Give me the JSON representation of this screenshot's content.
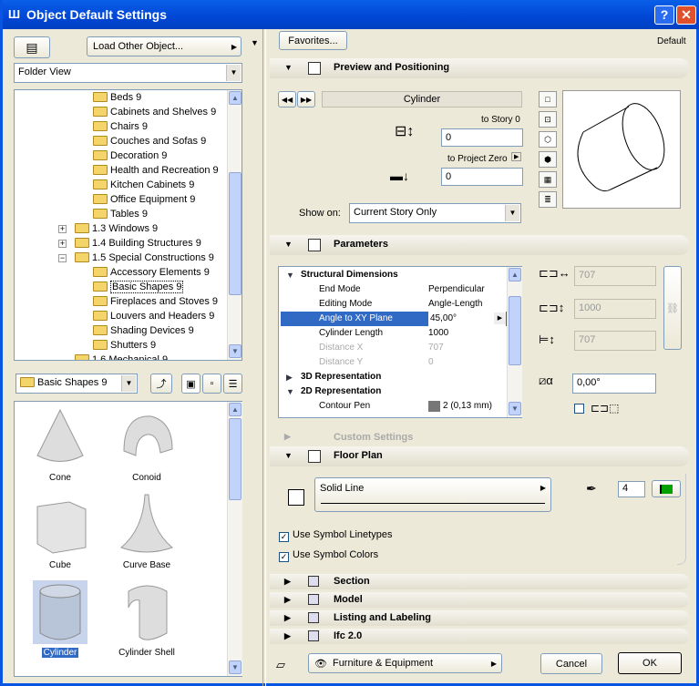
{
  "window": {
    "title": "Object Default Settings",
    "help": "?",
    "close": "✕"
  },
  "left": {
    "load_other": "Load Other Object...",
    "view_select": "Folder View",
    "tree": [
      {
        "label": "Beds 9",
        "level": 3
      },
      {
        "label": "Cabinets and Shelves 9",
        "level": 3
      },
      {
        "label": "Chairs 9",
        "level": 3
      },
      {
        "label": "Couches and Sofas 9",
        "level": 3
      },
      {
        "label": "Decoration 9",
        "level": 3
      },
      {
        "label": "Health and Recreation 9",
        "level": 3
      },
      {
        "label": "Kitchen Cabinets 9",
        "level": 3
      },
      {
        "label": "Office Equipment 9",
        "level": 3
      },
      {
        "label": "Tables 9",
        "level": 3
      },
      {
        "label": "1.3 Windows 9",
        "level": 2,
        "expander": "+"
      },
      {
        "label": "1.4 Building Structures 9",
        "level": 2,
        "expander": "+"
      },
      {
        "label": "1.5 Special Constructions 9",
        "level": 2,
        "expander": "-"
      },
      {
        "label": "Accessory Elements 9",
        "level": 3
      },
      {
        "label": "Basic Shapes 9",
        "level": 3,
        "selected": true
      },
      {
        "label": "Fireplaces and Stoves 9",
        "level": 3
      },
      {
        "label": "Louvers and Headers 9",
        "level": 3
      },
      {
        "label": "Shading Devices 9",
        "level": 3
      },
      {
        "label": "Shutters 9",
        "level": 3
      },
      {
        "label": "1.6 Mechanical 9",
        "level": 2
      }
    ],
    "folder_select": "Basic Shapes 9",
    "objects": [
      {
        "label": "Cone"
      },
      {
        "label": "Conoid"
      },
      {
        "label": "Cube"
      },
      {
        "label": "Curve Base"
      },
      {
        "label": "Cylinder",
        "selected": true
      },
      {
        "label": "Cylinder Shell"
      }
    ]
  },
  "right": {
    "favorites": "Favorites...",
    "default_label": "Default",
    "preview": {
      "title": "Preview and Positioning",
      "object_name": "Cylinder",
      "to_story_label": "to Story 0",
      "to_story_value": "0",
      "to_project_zero_label": "to Project Zero",
      "to_project_zero_value": "0",
      "show_on_label": "Show on:",
      "show_on_value": "Current Story Only"
    },
    "parameters": {
      "title": "Parameters",
      "rows": [
        {
          "key": "Structural Dimensions",
          "type": "group",
          "open": true
        },
        {
          "key": "End Mode",
          "value": "Perpendicular"
        },
        {
          "key": "Editing Mode",
          "value": "Angle-Length"
        },
        {
          "key": "Angle to XY Plane",
          "value": "45,00°",
          "selected": true
        },
        {
          "key": "Cylinder Length",
          "value": "1000"
        },
        {
          "key": "Distance X",
          "value": "707",
          "disabled": true
        },
        {
          "key": "Distance Y",
          "value": "0",
          "disabled": true
        },
        {
          "key": "3D Representation",
          "type": "group",
          "open": false
        },
        {
          "key": "2D Representation",
          "type": "group",
          "open": true
        },
        {
          "key": "Contour Pen",
          "value": "2 (0,13 mm)"
        }
      ],
      "width_value": "707",
      "height_value": "1000",
      "depth_value": "707",
      "angle_value": "0,00°"
    },
    "custom_settings": "Custom Settings",
    "floor_plan": {
      "title": "Floor Plan",
      "line_type": "Solid Line",
      "pen_value": "4",
      "use_symbol_linetypes": "Use Symbol Linetypes",
      "use_symbol_colors": "Use Symbol Colors"
    },
    "sections": [
      "Section",
      "Model",
      "Listing and Labeling",
      "Ifc 2.0"
    ],
    "layer_select": "Furniture & Equipment",
    "cancel": "Cancel",
    "ok": "OK"
  },
  "colors": {
    "title_bar": "#0054e3",
    "selection": "#316ac5",
    "pen_green": "#00a000"
  }
}
